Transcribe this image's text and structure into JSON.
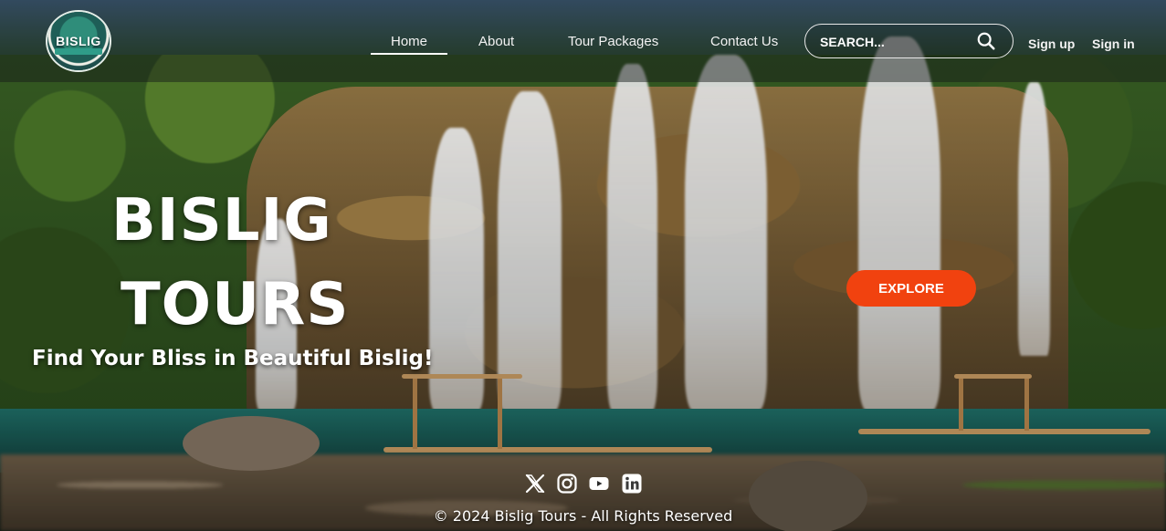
{
  "brand": {
    "logo_text": "BISLIG"
  },
  "nav": {
    "items": [
      {
        "label": "Home",
        "active": true
      },
      {
        "label": "About"
      },
      {
        "label": "Tour Packages"
      },
      {
        "label": "Contact Us"
      }
    ]
  },
  "search": {
    "placeholder": "SEARCH...",
    "value": ""
  },
  "auth": {
    "sign_up": "Sign up",
    "sign_in": "Sign in"
  },
  "hero": {
    "title_line1": "BISLIG",
    "title_line2": "TOURS",
    "subtitle": "Find Your Bliss in Beautiful Bislig!",
    "cta_label": "EXPLORE"
  },
  "footer": {
    "social_icons": [
      "x-icon",
      "instagram-icon",
      "youtube-icon",
      "linkedin-icon"
    ],
    "copyright": "© 2024 Bislig Tours - All Rights Reserved"
  },
  "colors": {
    "accent": "#f1420f",
    "text": "#ffffff"
  }
}
